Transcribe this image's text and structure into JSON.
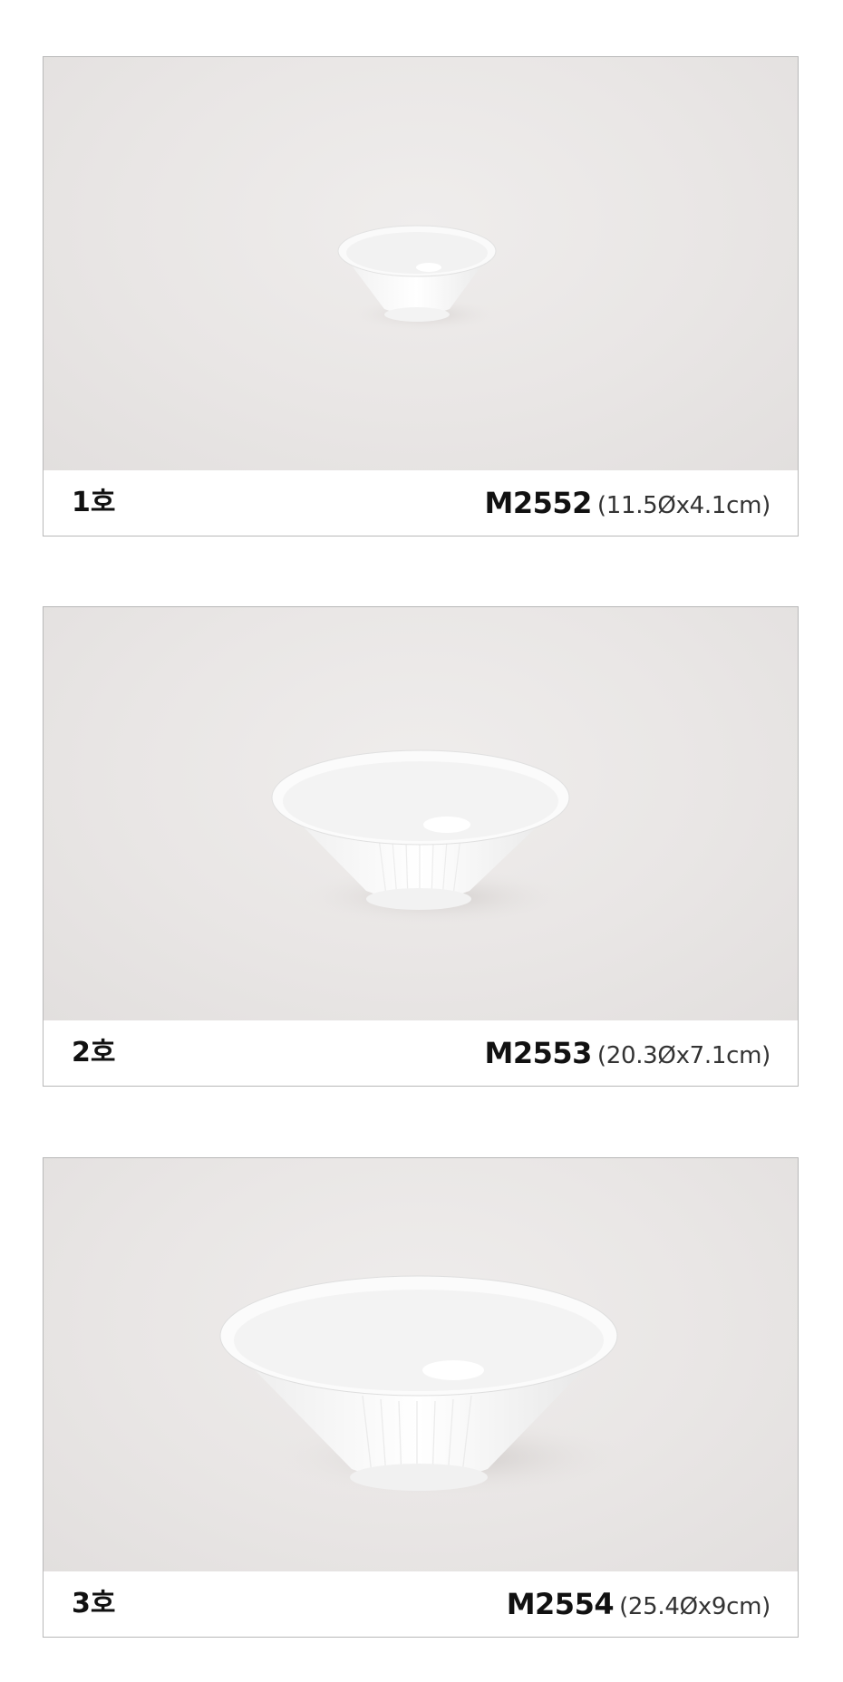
{
  "products": [
    {
      "size_label": "1호",
      "model_code": "M2552",
      "dimensions": "(11.5Øx4.1cm)"
    },
    {
      "size_label": "2호",
      "model_code": "M2553",
      "dimensions": "(20.3Øx7.1cm)"
    },
    {
      "size_label": "3호",
      "model_code": "M2554",
      "dimensions": "(25.4Øx9cm)"
    }
  ],
  "colors": {
    "background": "#e9e6e5",
    "bowl": "#fbfbfb",
    "border": "#b8b8b8",
    "text": "#111111"
  }
}
